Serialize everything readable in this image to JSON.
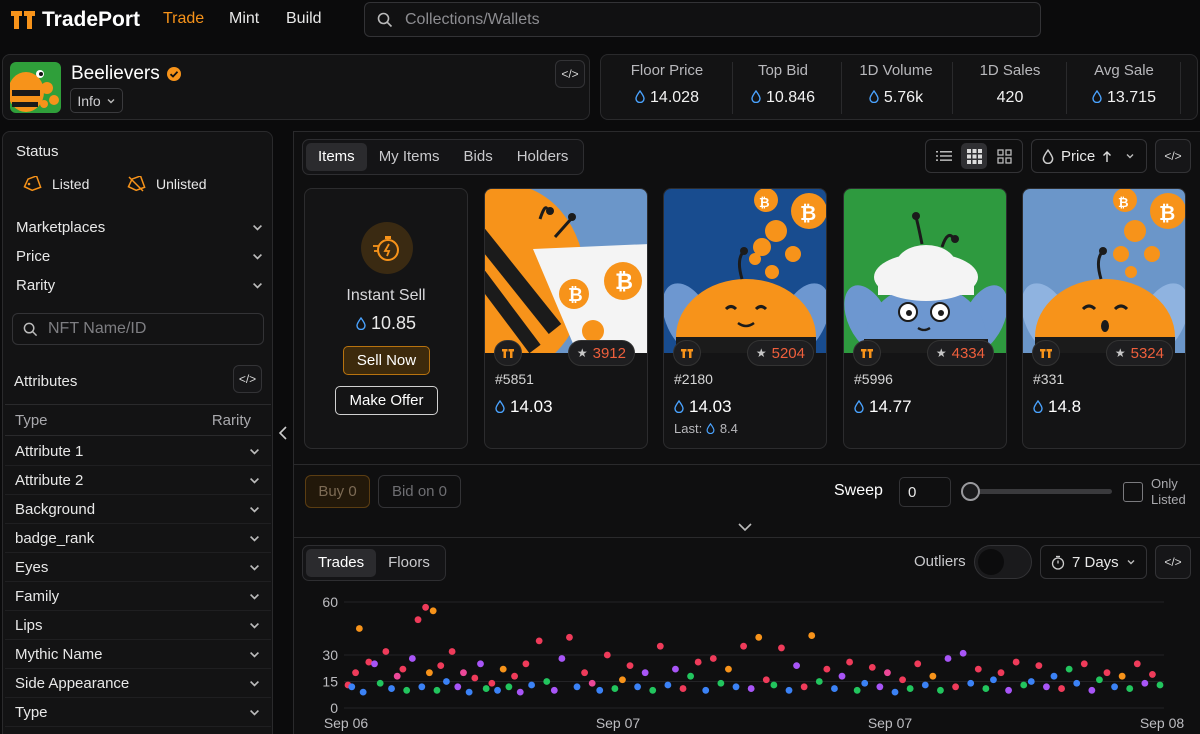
{
  "header": {
    "brand": "TradePort",
    "nav": [
      "Trade",
      "Mint",
      "Build"
    ],
    "search_placeholder": "Collections/Wallets"
  },
  "collection": {
    "name": "Beelievers",
    "info_label": "Info"
  },
  "stats": [
    {
      "label": "Floor Price",
      "value": "14.028"
    },
    {
      "label": "Top Bid",
      "value": "10.846"
    },
    {
      "label": "1D Volume",
      "value": "5.76k"
    },
    {
      "label": "1D Sales",
      "value": "420"
    },
    {
      "label": "Avg Sale",
      "value": "13.715"
    }
  ],
  "sidebar": {
    "status_title": "Status",
    "status_listed": "Listed",
    "status_unlisted": "Unlisted",
    "filters": [
      "Marketplaces",
      "Price",
      "Rarity"
    ],
    "search_placeholder": "NFT Name/ID",
    "attributes_title": "Attributes",
    "col_type": "Type",
    "col_rarity": "Rarity",
    "attributes": [
      "Attribute 1",
      "Attribute 2",
      "Background",
      "badge_rank",
      "Eyes",
      "Family",
      "Lips",
      "Mythic Name",
      "Side Appearance",
      "Type"
    ]
  },
  "items_tabs": [
    "Items",
    "My Items",
    "Bids",
    "Holders"
  ],
  "sort_label": "Price",
  "instant_sell": {
    "title": "Instant Sell",
    "price": "10.85",
    "sell_now": "Sell Now",
    "make_offer": "Make Offer"
  },
  "cards": [
    {
      "rank": "3912",
      "id": "#5851",
      "price": "14.03",
      "last": ""
    },
    {
      "rank": "5204",
      "id": "#2180",
      "price": "14.03",
      "last_label": "Last:",
      "last": "8.4"
    },
    {
      "rank": "4334",
      "id": "#5996",
      "price": "14.77",
      "last": ""
    },
    {
      "rank": "5324",
      "id": "#331",
      "price": "14.8",
      "last": ""
    }
  ],
  "actions": {
    "buy": "Buy 0",
    "bid": "Bid on 0",
    "sweep_label": "Sweep",
    "sweep_value": "0",
    "only_listed": "Only Listed"
  },
  "chart_tabs": [
    "Trades",
    "Floors"
  ],
  "outliers_label": "Outliers",
  "range_label": "7 Days",
  "colors": {
    "accent": "#f7931a",
    "rank": "#ef5f3c"
  },
  "chart_data": {
    "type": "scatter",
    "x_ticks": [
      "Sep 06",
      "Sep 07",
      "Sep 07",
      "Sep 08"
    ],
    "y_ticks": [
      60,
      30,
      15,
      0
    ],
    "ylim": [
      0,
      60
    ],
    "grid": true,
    "series_colors": [
      "#ef3b5a",
      "#f7931a",
      "#a855f7",
      "#3b82f6",
      "#22c55e",
      "#ec4899"
    ],
    "points": [
      [
        0.1,
        13,
        0
      ],
      [
        0.3,
        12,
        3
      ],
      [
        0.5,
        20,
        0
      ],
      [
        0.7,
        45,
        1
      ],
      [
        0.9,
        9,
        3
      ],
      [
        1.2,
        26,
        0
      ],
      [
        1.5,
        25,
        2
      ],
      [
        1.8,
        14,
        4
      ],
      [
        2.1,
        32,
        0
      ],
      [
        2.4,
        11,
        3
      ],
      [
        2.7,
        18,
        5
      ],
      [
        3.0,
        22,
        0
      ],
      [
        3.2,
        10,
        4
      ],
      [
        3.5,
        28,
        2
      ],
      [
        3.8,
        50,
        0
      ],
      [
        4.0,
        12,
        3
      ],
      [
        4.2,
        57,
        0
      ],
      [
        4.4,
        20,
        1
      ],
      [
        4.6,
        55,
        1
      ],
      [
        4.8,
        10,
        4
      ],
      [
        5.0,
        24,
        0
      ],
      [
        5.3,
        15,
        3
      ],
      [
        5.6,
        32,
        0
      ],
      [
        5.9,
        12,
        2
      ],
      [
        6.2,
        20,
        5
      ],
      [
        6.5,
        9,
        3
      ],
      [
        6.8,
        17,
        0
      ],
      [
        7.1,
        25,
        2
      ],
      [
        7.4,
        11,
        4
      ],
      [
        7.7,
        14,
        0
      ],
      [
        8.0,
        10,
        3
      ],
      [
        8.3,
        22,
        1
      ],
      [
        8.6,
        12,
        4
      ],
      [
        8.9,
        18,
        0
      ],
      [
        9.2,
        9,
        2
      ],
      [
        9.5,
        25,
        0
      ],
      [
        9.8,
        13,
        3
      ],
      [
        10.2,
        38,
        0
      ],
      [
        10.6,
        15,
        4
      ],
      [
        11.0,
        10,
        2
      ],
      [
        11.4,
        28,
        2
      ],
      [
        11.8,
        40,
        0
      ],
      [
        12.2,
        12,
        3
      ],
      [
        12.6,
        20,
        0
      ],
      [
        13.0,
        14,
        5
      ],
      [
        13.4,
        10,
        3
      ],
      [
        13.8,
        30,
        0
      ],
      [
        14.2,
        11,
        4
      ],
      [
        14.6,
        16,
        1
      ],
      [
        15.0,
        24,
        0
      ],
      [
        15.4,
        12,
        3
      ],
      [
        15.8,
        20,
        2
      ],
      [
        16.2,
        10,
        4
      ],
      [
        16.6,
        35,
        0
      ],
      [
        17.0,
        13,
        3
      ],
      [
        17.4,
        22,
        2
      ],
      [
        17.8,
        11,
        0
      ],
      [
        18.2,
        18,
        4
      ],
      [
        18.6,
        26,
        0
      ],
      [
        19.0,
        10,
        3
      ],
      [
        19.4,
        28,
        0
      ],
      [
        19.8,
        14,
        4
      ],
      [
        20.2,
        22,
        1
      ],
      [
        20.6,
        12,
        3
      ],
      [
        21.0,
        35,
        0
      ],
      [
        21.4,
        11,
        2
      ],
      [
        21.8,
        40,
        1
      ],
      [
        22.2,
        16,
        0
      ],
      [
        22.6,
        13,
        4
      ],
      [
        23.0,
        34,
        0
      ],
      [
        23.4,
        10,
        3
      ],
      [
        23.8,
        24,
        2
      ],
      [
        24.2,
        12,
        0
      ],
      [
        24.6,
        41,
        1
      ],
      [
        25.0,
        15,
        4
      ],
      [
        25.4,
        22,
        0
      ],
      [
        25.8,
        11,
        3
      ],
      [
        26.2,
        18,
        2
      ],
      [
        26.6,
        26,
        0
      ],
      [
        27.0,
        10,
        4
      ],
      [
        27.4,
        14,
        3
      ],
      [
        27.8,
        23,
        0
      ],
      [
        28.2,
        12,
        2
      ],
      [
        28.6,
        20,
        5
      ],
      [
        29.0,
        9,
        3
      ],
      [
        29.4,
        16,
        0
      ],
      [
        29.8,
        11,
        4
      ],
      [
        30.2,
        25,
        0
      ],
      [
        30.6,
        13,
        3
      ],
      [
        31.0,
        18,
        1
      ],
      [
        31.4,
        10,
        4
      ],
      [
        31.8,
        28,
        2
      ],
      [
        32.2,
        12,
        0
      ],
      [
        32.6,
        31,
        2
      ],
      [
        33.0,
        14,
        3
      ],
      [
        33.4,
        22,
        0
      ],
      [
        33.8,
        11,
        4
      ],
      [
        34.2,
        16,
        3
      ],
      [
        34.6,
        20,
        0
      ],
      [
        35.0,
        10,
        2
      ],
      [
        35.4,
        26,
        0
      ],
      [
        35.8,
        13,
        4
      ],
      [
        36.2,
        15,
        3
      ],
      [
        36.6,
        24,
        0
      ],
      [
        37.0,
        12,
        2
      ],
      [
        37.4,
        18,
        3
      ],
      [
        37.8,
        11,
        0
      ],
      [
        38.2,
        22,
        4
      ],
      [
        38.6,
        14,
        3
      ],
      [
        39.0,
        25,
        0
      ],
      [
        39.4,
        10,
        2
      ],
      [
        39.8,
        16,
        4
      ],
      [
        40.2,
        20,
        0
      ],
      [
        40.6,
        12,
        3
      ],
      [
        41.0,
        18,
        1
      ],
      [
        41.4,
        11,
        4
      ],
      [
        41.8,
        25,
        0
      ],
      [
        42.2,
        14,
        2
      ],
      [
        42.6,
        19,
        0
      ],
      [
        43.0,
        13,
        4
      ]
    ]
  }
}
